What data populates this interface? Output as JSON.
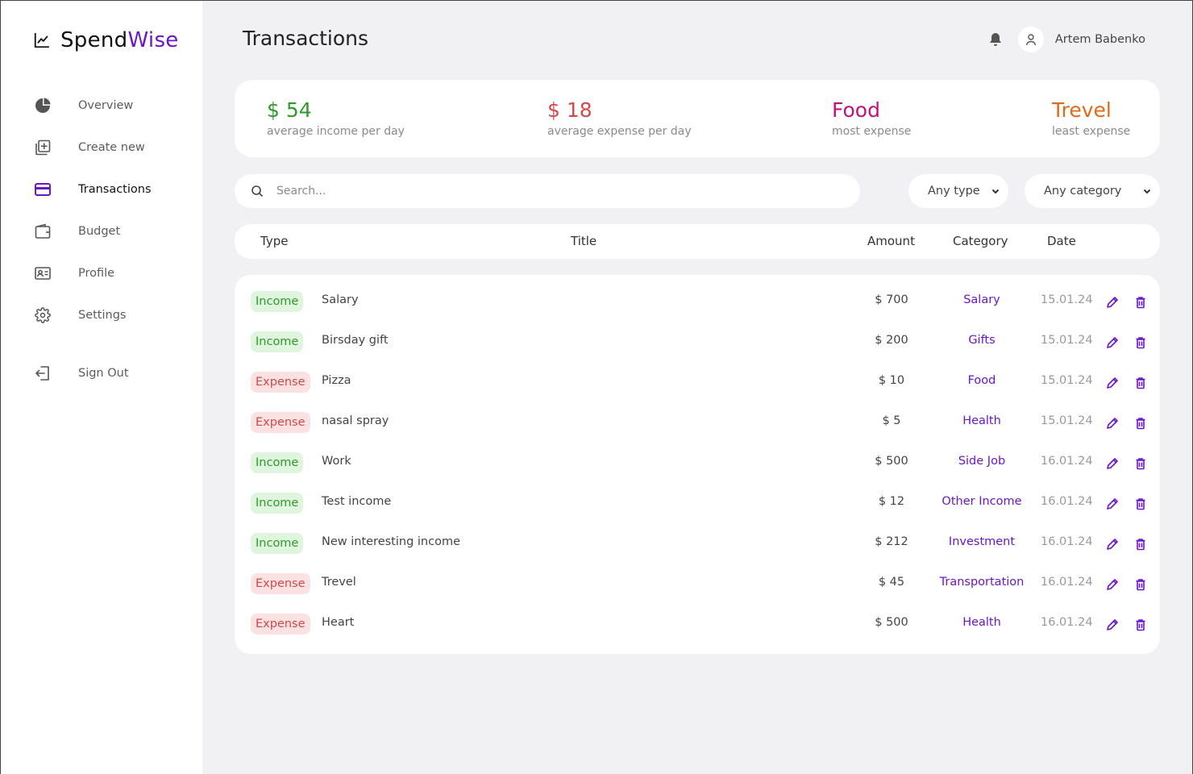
{
  "app": {
    "name_part1": "Spend",
    "name_part2": "Wise",
    "accent_color": "#6b16c8"
  },
  "sidebar": {
    "items": [
      {
        "label": "Overview",
        "icon": "pie-chart-icon",
        "active": false
      },
      {
        "label": "Create new",
        "icon": "add-square-icon",
        "active": false
      },
      {
        "label": "Transactions",
        "icon": "credit-card-icon",
        "active": true
      },
      {
        "label": "Budget",
        "icon": "wallet-icon",
        "active": false
      },
      {
        "label": "Profile",
        "icon": "id-card-icon",
        "active": false
      },
      {
        "label": "Settings",
        "icon": "gear-icon",
        "active": false
      }
    ],
    "signout_label": "Sign Out"
  },
  "header": {
    "title": "Transactions",
    "user_name": "Artem Babenko"
  },
  "stats": [
    {
      "value": "$ 54",
      "label": "average income per day",
      "color": "#2e9a2a"
    },
    {
      "value": "$ 18",
      "label": "average expense per day",
      "color": "#d24a4a"
    },
    {
      "value": "Food",
      "label": "most expense",
      "color": "#c2127a"
    },
    {
      "value": "Trevel",
      "label": "least expense",
      "color": "#e06a1a"
    }
  ],
  "filters": {
    "search_placeholder": "Search...",
    "type_selected": "Any type",
    "category_selected": "Any category"
  },
  "table": {
    "columns": [
      "Type",
      "Title",
      "Amount",
      "Category",
      "Date"
    ],
    "rows": [
      {
        "type": "Income",
        "title": "Salary",
        "amount": "$ 700",
        "category": "Salary",
        "date": "15.01.24"
      },
      {
        "type": "Income",
        "title": "Birsday gift",
        "amount": "$ 200",
        "category": "Gifts",
        "date": "15.01.24"
      },
      {
        "type": "Expense",
        "title": "Pizza",
        "amount": "$ 10",
        "category": "Food",
        "date": "15.01.24"
      },
      {
        "type": "Expense",
        "title": "nasal spray",
        "amount": "$ 5",
        "category": "Health",
        "date": "15.01.24"
      },
      {
        "type": "Income",
        "title": "Work",
        "amount": "$ 500",
        "category": "Side Job",
        "date": "16.01.24"
      },
      {
        "type": "Income",
        "title": "Test income",
        "amount": "$ 12",
        "category": "Other Income",
        "date": "16.01.24"
      },
      {
        "type": "Income",
        "title": "New interesting income",
        "amount": "$ 212",
        "category": "Investment",
        "date": "16.01.24"
      },
      {
        "type": "Expense",
        "title": "Trevel",
        "amount": "$ 45",
        "category": "Transportation",
        "date": "16.01.24"
      },
      {
        "type": "Expense",
        "title": "Heart",
        "amount": "$ 500",
        "category": "Health",
        "date": "16.01.24"
      }
    ]
  }
}
